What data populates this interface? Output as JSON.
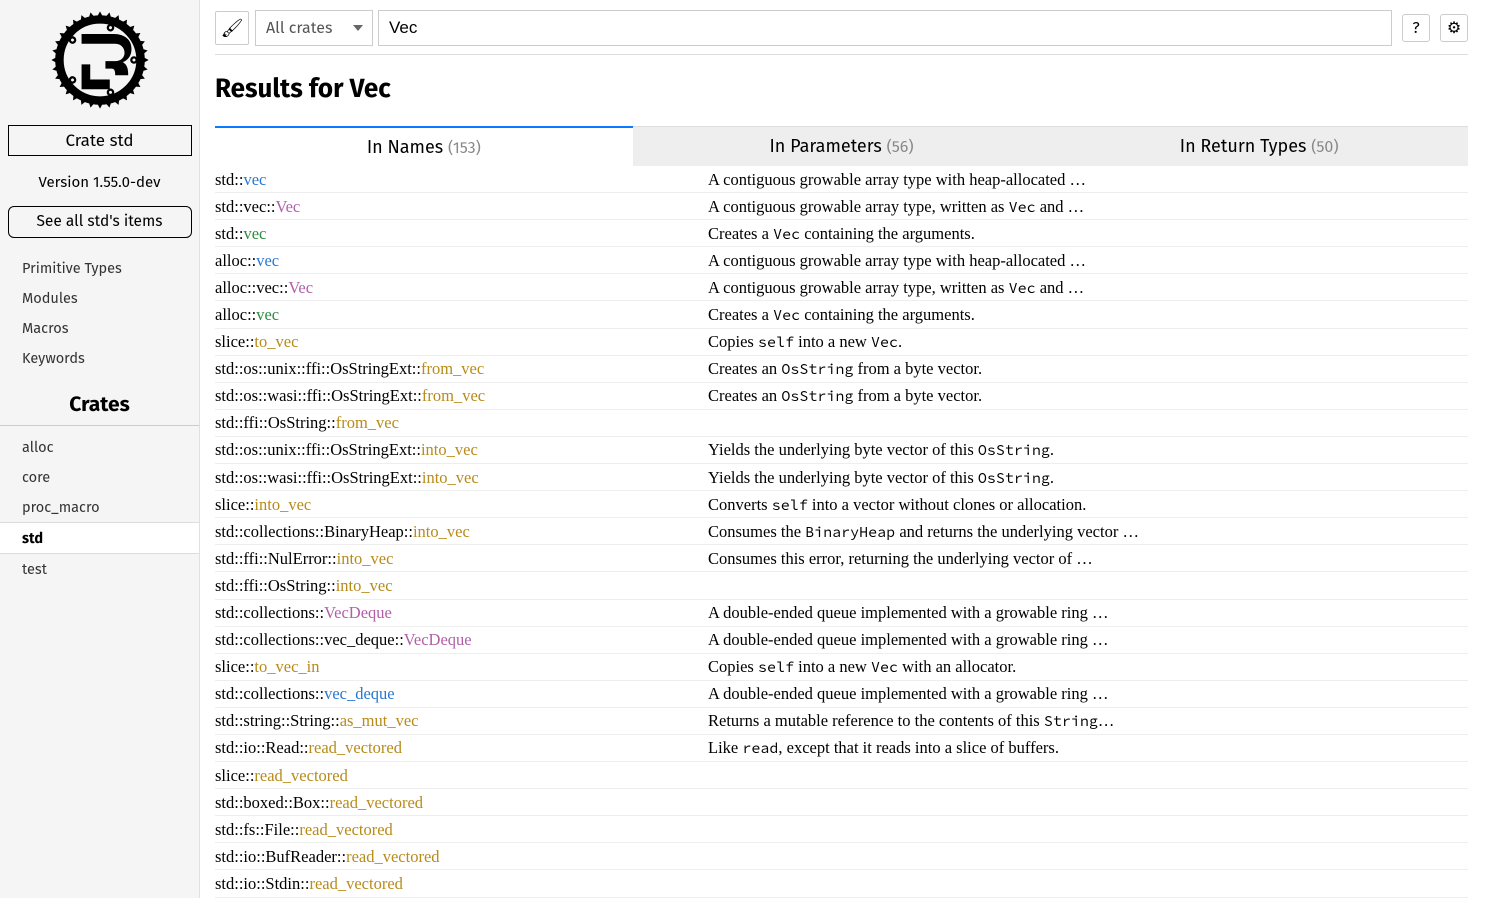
{
  "sidebar": {
    "crate_box": "Crate std",
    "version": "Version 1.55.0-dev",
    "see_all": "See all std's items",
    "nav": [
      "Primitive Types",
      "Modules",
      "Macros",
      "Keywords"
    ],
    "crates_header": "Crates",
    "crates": [
      "alloc",
      "core",
      "proc_macro",
      "std",
      "test"
    ],
    "active_crate": "std"
  },
  "topbar": {
    "select_label": "All crates",
    "search_value": "Vec",
    "help_label": "?",
    "settings_label": "⚙"
  },
  "results_title": "Results for Vec",
  "tabs": [
    {
      "label": "In Names",
      "count": "(153)"
    },
    {
      "label": "In Parameters",
      "count": "(56)"
    },
    {
      "label": "In Return Types",
      "count": "(50)"
    }
  ],
  "rows": [
    {
      "pre": "std::",
      "last": "vec",
      "cls": "c-mod",
      "desc": "A contiguous growable array type with heap-allocated …"
    },
    {
      "pre": "std::vec::",
      "last": "Vec",
      "cls": "c-struct",
      "desc_html": "A contiguous growable array type, written as <code>Vec</code> and …"
    },
    {
      "pre": "std::",
      "last": "vec",
      "cls": "c-macro",
      "desc_html": "Creates a <code>Vec</code> containing the arguments."
    },
    {
      "pre": "alloc::",
      "last": "vec",
      "cls": "c-mod",
      "desc": "A contiguous growable array type with heap-allocated …"
    },
    {
      "pre": "alloc::vec::",
      "last": "Vec",
      "cls": "c-struct",
      "desc_html": "A contiguous growable array type, written as <code>Vec</code> and …"
    },
    {
      "pre": "alloc::",
      "last": "vec",
      "cls": "c-macro",
      "desc_html": "Creates a <code>Vec</code> containing the arguments."
    },
    {
      "pre": "slice::",
      "last": "to_vec",
      "cls": "c-fn",
      "desc_html": "Copies <code>self</code> into a new <code>Vec</code>."
    },
    {
      "pre": "std::os::unix::ffi::OsStringExt::",
      "last": "from_vec",
      "cls": "c-fn",
      "desc_html": "Creates an <code>OsString</code> from a byte vector."
    },
    {
      "pre": "std::os::wasi::ffi::OsStringExt::",
      "last": "from_vec",
      "cls": "c-fn",
      "desc_html": "Creates an <code>OsString</code> from a byte vector."
    },
    {
      "pre": "std::ffi::OsString::",
      "last": "from_vec",
      "cls": "c-fn",
      "desc": ""
    },
    {
      "pre": "std::os::unix::ffi::OsStringExt::",
      "last": "into_vec",
      "cls": "c-fn",
      "desc_html": "Yields the underlying byte vector of this <code>OsString</code>."
    },
    {
      "pre": "std::os::wasi::ffi::OsStringExt::",
      "last": "into_vec",
      "cls": "c-fn",
      "desc_html": "Yields the underlying byte vector of this <code>OsString</code>."
    },
    {
      "pre": "slice::",
      "last": "into_vec",
      "cls": "c-fn",
      "desc_html": "Converts <code>self</code> into a vector without clones or allocation."
    },
    {
      "pre": "std::collections::BinaryHeap::",
      "last": "into_vec",
      "cls": "c-fn",
      "desc_html": "Consumes the <code>BinaryHeap</code> and returns the underlying vector …"
    },
    {
      "pre": "std::ffi::NulError::",
      "last": "into_vec",
      "cls": "c-fn",
      "desc": "Consumes this error, returning the underlying vector of …"
    },
    {
      "pre": "std::ffi::OsString::",
      "last": "into_vec",
      "cls": "c-fn",
      "desc": ""
    },
    {
      "pre": "std::collections::",
      "last": "VecDeque",
      "cls": "c-struct",
      "desc": "A double-ended queue implemented with a growable ring …"
    },
    {
      "pre": "std::collections::vec_deque::",
      "last": "VecDeque",
      "cls": "c-struct",
      "desc": "A double-ended queue implemented with a growable ring …"
    },
    {
      "pre": "slice::",
      "last": "to_vec_in",
      "cls": "c-fn",
      "desc_html": "Copies <code>self</code> into a new <code>Vec</code> with an allocator."
    },
    {
      "pre": "std::collections::",
      "last": "vec_deque",
      "cls": "c-mod",
      "desc": "A double-ended queue implemented with a growable ring …"
    },
    {
      "pre": "std::string::String::",
      "last": "as_mut_vec",
      "cls": "c-fn",
      "desc_html": "Returns a mutable reference to the contents of this <code>String</code>…"
    },
    {
      "pre": "std::io::Read::",
      "last": "read_vectored",
      "cls": "c-fn",
      "desc_html": "Like <code>read</code>, except that it reads into a slice of buffers."
    },
    {
      "pre": "slice::",
      "last": "read_vectored",
      "cls": "c-fn",
      "desc": ""
    },
    {
      "pre": "std::boxed::Box::",
      "last": "read_vectored",
      "cls": "c-fn",
      "desc": ""
    },
    {
      "pre": "std::fs::File::",
      "last": "read_vectored",
      "cls": "c-fn",
      "desc": ""
    },
    {
      "pre": "std::io::BufReader::",
      "last": "read_vectored",
      "cls": "c-fn",
      "desc": ""
    },
    {
      "pre": "std::io::Stdin::",
      "last": "read_vectored",
      "cls": "c-fn",
      "desc": ""
    }
  ]
}
